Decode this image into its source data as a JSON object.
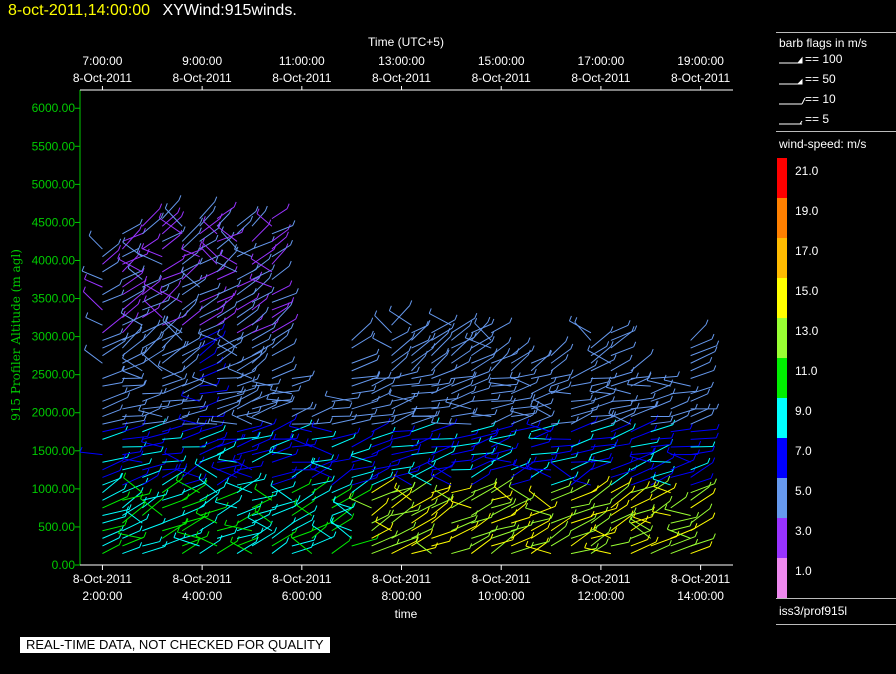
{
  "header": {
    "datetime": "8-oct-2011,14:00:00",
    "title": "XYWind:915winds."
  },
  "chart_data": {
    "type": "wind-barb profile",
    "top_axis_title": "Time (UTC+5)",
    "top_ticks": [
      {
        "time": "7:00:00",
        "date": "8-Oct-2011"
      },
      {
        "time": "9:00:00",
        "date": "8-Oct-2011"
      },
      {
        "time": "11:00:00",
        "date": "8-Oct-2011"
      },
      {
        "time": "13:00:00",
        "date": "8-Oct-2011"
      },
      {
        "time": "15:00:00",
        "date": "8-Oct-2011"
      },
      {
        "time": "17:00:00",
        "date": "8-Oct-2011"
      },
      {
        "time": "19:00:00",
        "date": "8-Oct-2011"
      }
    ],
    "bottom_ticks": [
      {
        "date": "8-Oct-2011",
        "time": "2:00:00"
      },
      {
        "date": "8-Oct-2011",
        "time": "4:00:00"
      },
      {
        "date": "8-Oct-2011",
        "time": "6:00:00"
      },
      {
        "date": "8-Oct-2011",
        "time": "8:00:00"
      },
      {
        "date": "8-Oct-2011",
        "time": "10:00:00"
      },
      {
        "date": "8-Oct-2011",
        "time": "12:00:00"
      },
      {
        "date": "8-Oct-2011",
        "time": "14:00:00"
      }
    ],
    "xlabel": "time",
    "ylabel": "915 Profiler Altitude (m agl)",
    "ylim": [
      0,
      6200
    ],
    "y_ticks": [
      "0.00",
      "500.00",
      "1000.00",
      "1500.00",
      "2000.00",
      "2500.00",
      "3000.00",
      "3500.00",
      "4000.00",
      "4500.00",
      "5000.00",
      "5500.00",
      "6000.00"
    ],
    "axis_color": "#00cc00",
    "profiles": [
      {
        "hour": 2.0,
        "top": 4200
      },
      {
        "hour": 2.4,
        "top": 4400
      },
      {
        "hour": 2.8,
        "top": 4450
      },
      {
        "hour": 3.2,
        "top": 4550
      },
      {
        "hour": 3.6,
        "top": 4550
      },
      {
        "hour": 3.95,
        "top": 4550
      },
      {
        "hour": 4.3,
        "top": 4550
      },
      {
        "hour": 4.7,
        "top": 4450
      },
      {
        "hour": 5.0,
        "top": 4500
      },
      {
        "hour": 5.4,
        "top": 4550
      },
      {
        "hour": 5.8,
        "top": 2500
      },
      {
        "hour": 6.2,
        "top": 2000
      },
      {
        "hour": 6.6,
        "top": 2150
      },
      {
        "hour": 7.0,
        "top": 3000
      },
      {
        "hour": 7.4,
        "top": 2500
      },
      {
        "hour": 7.8,
        "top": 3200
      },
      {
        "hour": 8.2,
        "top": 3250
      },
      {
        "hour": 8.6,
        "top": 3050
      },
      {
        "hour": 9.0,
        "top": 3150
      },
      {
        "hour": 9.4,
        "top": 3100
      },
      {
        "hour": 9.8,
        "top": 3100
      },
      {
        "hour": 10.2,
        "top": 2800
      },
      {
        "hour": 10.6,
        "top": 2700
      },
      {
        "hour": 11.0,
        "top": 2750
      },
      {
        "hour": 11.4,
        "top": 2500
      },
      {
        "hour": 11.8,
        "top": 3100
      },
      {
        "hour": 12.2,
        "top": 3150
      },
      {
        "hour": 12.6,
        "top": 2600
      },
      {
        "hour": 13.0,
        "top": 2450
      },
      {
        "hour": 13.4,
        "top": 2350
      },
      {
        "hour": 13.8,
        "top": 3000
      }
    ]
  },
  "legend": {
    "barb_title": "barb flags in m/s",
    "barbs": [
      "== 100",
      "== 50",
      "== 10",
      "== 5"
    ],
    "speed_title": "wind-speed: m/s",
    "speed_scale": [
      {
        "label": "21.0",
        "color": "#ff0000"
      },
      {
        "label": "19.0",
        "color": "#ff8000"
      },
      {
        "label": "17.0",
        "color": "#ffbb00"
      },
      {
        "label": "15.0",
        "color": "#ffff00"
      },
      {
        "label": "13.0",
        "color": "#99ff33"
      },
      {
        "label": "11.0",
        "color": "#00ee00"
      },
      {
        "label": "9.0",
        "color": "#00ffff"
      },
      {
        "label": "7.0",
        "color": "#0000ff"
      },
      {
        "label": "5.0",
        "color": "#6699ee"
      },
      {
        "label": "3.0",
        "color": "#9933ff"
      },
      {
        "label": "1.0",
        "color": "#ee88ee"
      }
    ],
    "station": "iss3/prof915l"
  },
  "footer": {
    "qc_note": "REAL-TIME DATA, NOT CHECKED FOR QUALITY"
  }
}
